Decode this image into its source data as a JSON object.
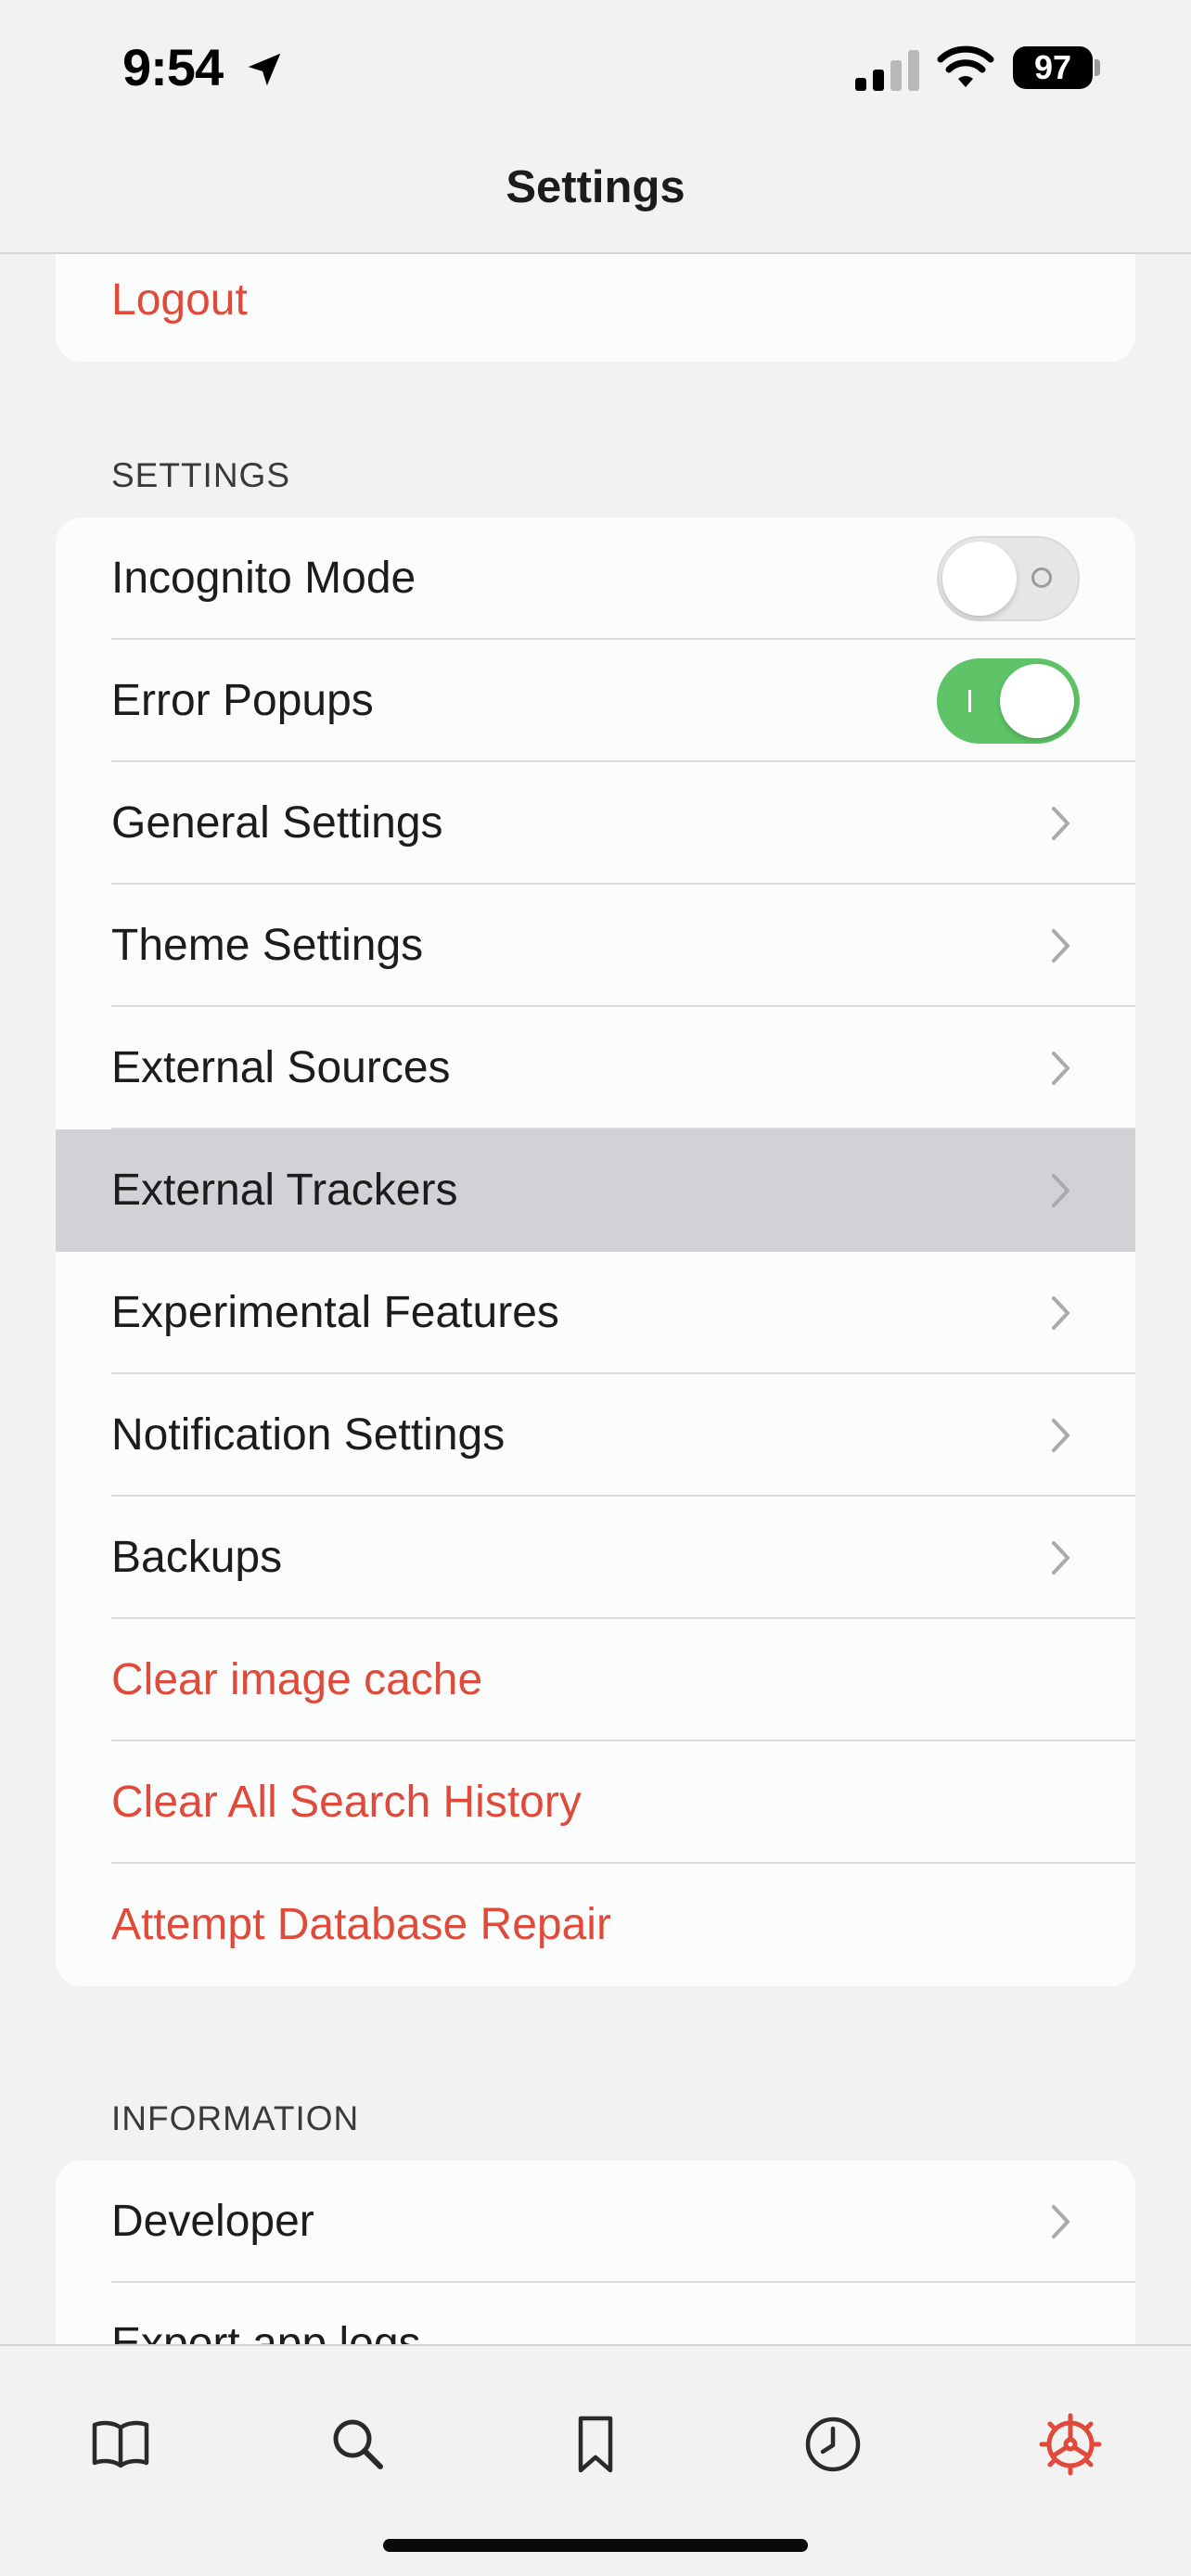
{
  "status_bar": {
    "time": "9:54",
    "battery": "97"
  },
  "nav": {
    "title": "Settings"
  },
  "account_group": {
    "logout_label": "Logout"
  },
  "settings_section": {
    "header": "SETTINGS",
    "incognito_label": "Incognito Mode",
    "incognito_on": false,
    "error_popups_label": "Error Popups",
    "error_popups_on": true,
    "items": [
      {
        "label": "General Settings"
      },
      {
        "label": "Theme Settings"
      },
      {
        "label": "External Sources"
      },
      {
        "label": "External Trackers",
        "highlighted": true
      },
      {
        "label": "Experimental Features"
      },
      {
        "label": "Notification Settings"
      },
      {
        "label": "Backups"
      }
    ],
    "actions": [
      {
        "label": "Clear image cache"
      },
      {
        "label": "Clear All Search History"
      },
      {
        "label": "Attempt Database Repair"
      }
    ]
  },
  "information_section": {
    "header": "INFORMATION",
    "items": [
      {
        "label": "Developer"
      },
      {
        "label": "Export app logs"
      }
    ]
  },
  "tab_bar": {
    "tabs": [
      {
        "icon": "book-icon",
        "name": "library"
      },
      {
        "icon": "search-icon",
        "name": "search"
      },
      {
        "icon": "bookmark-icon",
        "name": "bookmarks"
      },
      {
        "icon": "clock-icon",
        "name": "history"
      },
      {
        "icon": "gear-icon",
        "name": "settings",
        "active": true
      }
    ]
  },
  "colors": {
    "accent": "#e04a3b",
    "toggle_on": "#5ec467",
    "background": "#f2f2f2",
    "card": "#fbfdfd",
    "highlight_row": "#d1d1d6"
  }
}
